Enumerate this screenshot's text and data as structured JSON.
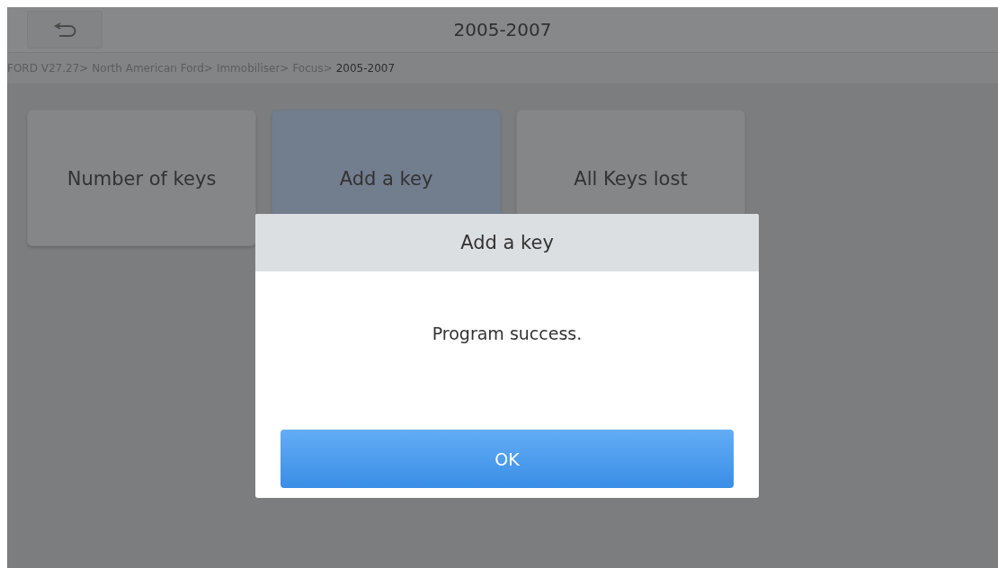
{
  "header": {
    "title": "2005-2007"
  },
  "breadcrumb": [
    {
      "label": "FORD V27.27>",
      "current": false
    },
    {
      "label": "North American Ford>",
      "current": false
    },
    {
      "label": "Immobiliser>",
      "current": false
    },
    {
      "label": "Focus>",
      "current": false
    },
    {
      "label": "2005-2007",
      "current": true
    }
  ],
  "tiles": [
    {
      "label": "Number of keys",
      "selected": false
    },
    {
      "label": "Add a key",
      "selected": true
    },
    {
      "label": "All Keys lost",
      "selected": false
    }
  ],
  "dialog": {
    "title": "Add a key",
    "message": "Program success.",
    "button": "OK"
  }
}
